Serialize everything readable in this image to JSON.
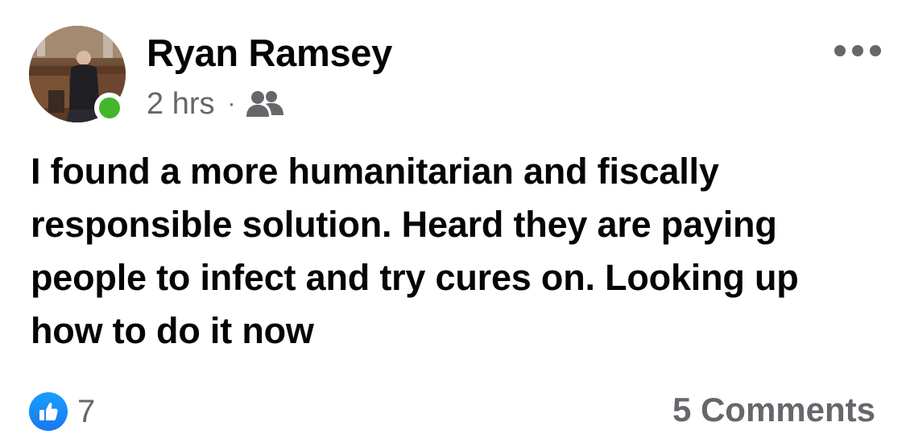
{
  "post": {
    "author": "Ryan Ramsey",
    "time": "2 hrs",
    "separator": "·",
    "audience_icon": "friends-icon",
    "body": "I found a more humanitarian and fiscally responsible solution. Heard they are paying people to infect and try cures on. Looking up how to do it now",
    "reactions": {
      "icon": "like-icon",
      "count": "7"
    },
    "comments_label": "5 Comments",
    "more_icon": "more-options-icon"
  },
  "colors": {
    "online": "#42b72a",
    "like_blue": "#1877f2",
    "secondary_text": "#65676b",
    "primary_text": "#050505"
  }
}
